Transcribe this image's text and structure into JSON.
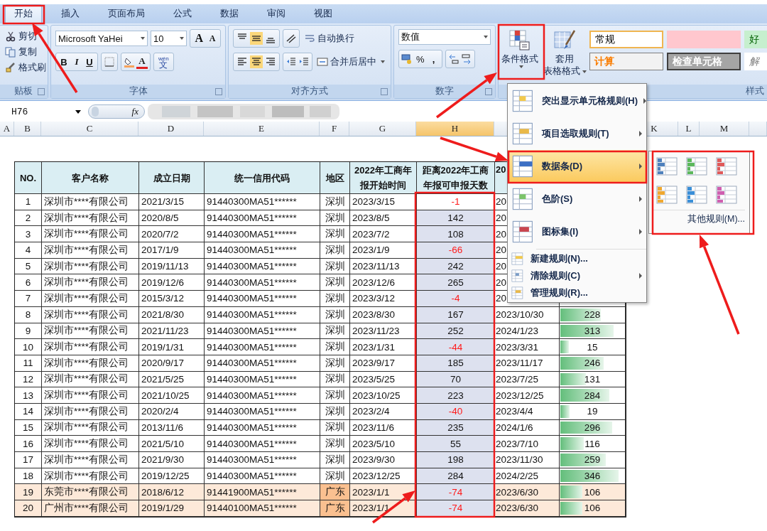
{
  "tabs": [
    {
      "label": "开始",
      "selected": true
    },
    {
      "label": "插入",
      "selected": false
    },
    {
      "label": "页面布局",
      "selected": false
    },
    {
      "label": "公式",
      "selected": false
    },
    {
      "label": "数据",
      "selected": false
    },
    {
      "label": "审阅",
      "selected": false
    },
    {
      "label": "视图",
      "selected": false
    }
  ],
  "ribbon": {
    "clipboard": {
      "label": "贴板",
      "items": [
        "剪切",
        "复制",
        "格式刷"
      ]
    },
    "font": {
      "label": "字体",
      "family": "Microsoft YaHei",
      "size": "10",
      "grow": "A",
      "shrink": "A",
      "bold": "B",
      "italic": "I",
      "underline": "U",
      "color_letter": "A",
      "phonetic_top": "wén",
      "phonetic": "文"
    },
    "alignment": {
      "label": "对齐方式",
      "vertical": [
        {
          "kind": "top",
          "selected": false
        },
        {
          "kind": "middle",
          "selected": true
        },
        {
          "kind": "bottom",
          "selected": false
        }
      ],
      "horizontal": [
        {
          "kind": "left",
          "selected": false
        },
        {
          "kind": "center",
          "selected": true
        },
        {
          "kind": "right",
          "selected": false
        }
      ],
      "wrap": "自动换行",
      "merge": "合并后居中"
    },
    "number": {
      "label": "数字",
      "format": "数值",
      "percent": "%",
      "comma": ","
    },
    "styles": {
      "label": "样式",
      "conditional": "条件格式",
      "table_format": [
        "套用",
        "表格格式"
      ],
      "cells": [
        {
          "kind": "normal",
          "text": "常规"
        },
        {
          "kind": "bad"
        },
        {
          "kind": "good",
          "text": "好"
        },
        {
          "kind": "calc",
          "text": "计算"
        },
        {
          "kind": "check",
          "text": "检查单元格"
        },
        {
          "kind": "explain",
          "text": "解"
        }
      ]
    }
  },
  "name_box": "H76",
  "fx": "fx",
  "columns": [
    {
      "label": "A",
      "selected": false
    },
    {
      "label": "B",
      "selected": false
    },
    {
      "label": "C",
      "selected": false
    },
    {
      "label": "D",
      "selected": false
    },
    {
      "label": "E",
      "selected": false
    },
    {
      "label": "F",
      "selected": false
    },
    {
      "label": "G",
      "selected": false
    },
    {
      "label": "H",
      "selected": true
    }
  ],
  "columns_right": [
    {
      "label": "K",
      "selected": false
    },
    {
      "label": "L",
      "selected": false
    },
    {
      "label": "M",
      "selected": false
    }
  ],
  "table": {
    "headers": [
      [
        "NO."
      ],
      [
        "客户名称"
      ],
      [
        "成立日期"
      ],
      [
        "统一信用代码"
      ],
      [
        "地区"
      ],
      [
        "2022年工商年",
        "报开始时间"
      ],
      [
        "距离2022年工商",
        "年报可申报天数"
      ],
      [
        "20"
      ]
    ],
    "rows": [
      {
        "no": "1",
        "name": "深圳市****有限公司",
        "founded": "2021/3/15",
        "code": "91440300MA51******",
        "region": "深圳",
        "start": "2023/3/15",
        "days": {
          "text": "-1",
          "negative": true,
          "active": true
        },
        "due": "20",
        "highlight": false
      },
      {
        "no": "2",
        "name": "深圳市****有限公司",
        "founded": "2020/8/5",
        "code": "91440300MA51******",
        "region": "深圳",
        "start": "2023/8/5",
        "days": {
          "text": "142",
          "negative": false,
          "active": false
        },
        "due": "20",
        "highlight": false
      },
      {
        "no": "3",
        "name": "深圳市****有限公司",
        "founded": "2020/7/2",
        "code": "91440300MA51******",
        "region": "深圳",
        "start": "2023/7/2",
        "days": {
          "text": "108",
          "negative": false,
          "active": false
        },
        "due": "20",
        "highlight": false
      },
      {
        "no": "4",
        "name": "深圳市****有限公司",
        "founded": "2017/1/9",
        "code": "91440300MA51******",
        "region": "深圳",
        "start": "2023/1/9",
        "days": {
          "text": "-66",
          "negative": true,
          "active": false
        },
        "due": "20",
        "highlight": false
      },
      {
        "no": "5",
        "name": "深圳市****有限公司",
        "founded": "2019/11/13",
        "code": "91440300MA51******",
        "region": "深圳",
        "start": "2023/11/13",
        "days": {
          "text": "242",
          "negative": false,
          "active": false
        },
        "due": "20",
        "highlight": false
      },
      {
        "no": "6",
        "name": "深圳市****有限公司",
        "founded": "2019/12/6",
        "code": "91440300MA51******",
        "region": "深圳",
        "start": "2023/12/6",
        "days": {
          "text": "265",
          "negative": false,
          "active": false
        },
        "due": "20",
        "highlight": false
      },
      {
        "no": "7",
        "name": "深圳市****有限公司",
        "founded": "2015/3/12",
        "code": "91440300MA51******",
        "region": "深圳",
        "start": "2023/3/12",
        "days": {
          "text": "-4",
          "negative": true,
          "active": false
        },
        "due": "20",
        "highlight": false
      },
      {
        "no": "8",
        "name": "深圳市****有限公司",
        "founded": "2021/8/30",
        "code": "91440300MA51******",
        "region": "深圳",
        "start": "2023/8/30",
        "days": {
          "text": "167",
          "negative": false,
          "active": false
        },
        "due": "2023/10/30",
        "overdue": {
          "text": "228",
          "level": 0.62
        },
        "highlight": false
      },
      {
        "no": "9",
        "name": "深圳市****有限公司",
        "founded": "2021/11/23",
        "code": "91440300MA51******",
        "region": "深圳",
        "start": "2023/11/23",
        "days": {
          "text": "252",
          "negative": false,
          "active": false
        },
        "due": "2024/1/23",
        "overdue": {
          "text": "313",
          "level": 0.82
        },
        "highlight": false
      },
      {
        "no": "10",
        "name": "深圳市****有限公司",
        "founded": "2019/1/31",
        "code": "91440300MA51******",
        "region": "深圳",
        "start": "2023/1/31",
        "days": {
          "text": "-44",
          "negative": true,
          "active": false
        },
        "due": "2023/3/31",
        "overdue": {
          "text": "15",
          "level": 0.13
        },
        "highlight": false
      },
      {
        "no": "11",
        "name": "深圳市****有限公司",
        "founded": "2020/9/17",
        "code": "91440300MA51******",
        "region": "深圳",
        "start": "2023/9/17",
        "days": {
          "text": "185",
          "negative": false,
          "active": false
        },
        "due": "2023/11/17",
        "overdue": {
          "text": "246",
          "level": 0.66
        },
        "highlight": false
      },
      {
        "no": "12",
        "name": "深圳市****有限公司",
        "founded": "2021/5/25",
        "code": "91440300MA51******",
        "region": "深圳",
        "start": "2023/5/25",
        "days": {
          "text": "70",
          "negative": false,
          "active": false
        },
        "due": "2023/7/25",
        "overdue": {
          "text": "131",
          "level": 0.39
        },
        "highlight": false
      },
      {
        "no": "13",
        "name": "深圳市****有限公司",
        "founded": "2021/10/25",
        "code": "91440300MA51******",
        "region": "深圳",
        "start": "2023/10/25",
        "days": {
          "text": "223",
          "negative": false,
          "active": false
        },
        "due": "2023/12/25",
        "overdue": {
          "text": "284",
          "level": 0.75
        },
        "highlight": false
      },
      {
        "no": "14",
        "name": "深圳市****有限公司",
        "founded": "2020/2/4",
        "code": "91440300MA51******",
        "region": "深圳",
        "start": "2023/2/4",
        "days": {
          "text": "-40",
          "negative": true,
          "active": false
        },
        "due": "2023/4/4",
        "overdue": {
          "text": "19",
          "level": 0.14
        },
        "highlight": false
      },
      {
        "no": "15",
        "name": "深圳市****有限公司",
        "founded": "2013/11/6",
        "code": "91440300MA51******",
        "region": "深圳",
        "start": "2023/11/6",
        "days": {
          "text": "235",
          "negative": false,
          "active": false
        },
        "due": "2024/1/6",
        "overdue": {
          "text": "296",
          "level": 0.79
        },
        "highlight": false
      },
      {
        "no": "16",
        "name": "深圳市****有限公司",
        "founded": "2021/5/10",
        "code": "91440300MA51******",
        "region": "深圳",
        "start": "2023/5/10",
        "days": {
          "text": "55",
          "negative": false,
          "active": false
        },
        "due": "2023/7/10",
        "overdue": {
          "text": "116",
          "level": 0.36
        },
        "highlight": false
      },
      {
        "no": "17",
        "name": "深圳市****有限公司",
        "founded": "2021/9/30",
        "code": "91440300MA51******",
        "region": "深圳",
        "start": "2023/9/30",
        "days": {
          "text": "198",
          "negative": false,
          "active": false
        },
        "due": "2023/11/30",
        "overdue": {
          "text": "259",
          "level": 0.7
        },
        "highlight": false
      },
      {
        "no": "18",
        "name": "深圳市****有限公司",
        "founded": "2019/12/25",
        "code": "91440300MA51******",
        "region": "深圳",
        "start": "2023/12/25",
        "days": {
          "text": "284",
          "negative": false,
          "active": false
        },
        "due": "2024/2/25",
        "overdue": {
          "text": "346",
          "level": 0.89
        },
        "highlight": false
      },
      {
        "no": "19",
        "name": "东莞市****有限公司",
        "founded": "2018/6/12",
        "code": "91441900MA51******",
        "region": "广东",
        "start": "2023/1/1",
        "days": {
          "text": "-74",
          "negative": true,
          "active": false
        },
        "due": "2023/6/30",
        "overdue": {
          "text": "106",
          "level": 0.34
        },
        "highlight": true
      },
      {
        "no": "20",
        "name": "广州市****有限公司",
        "founded": "2019/1/29",
        "code": "91440100MA51******",
        "region": "广东",
        "start": "2023/1/1",
        "days": {
          "text": "-74",
          "negative": true,
          "active": false
        },
        "due": "2023/6/30",
        "overdue": {
          "text": "106",
          "level": 0.34
        },
        "highlight": true
      }
    ]
  },
  "menu": {
    "items": [
      {
        "kind": "large",
        "label": "突出显示单元格规则(H)",
        "submenu": true,
        "selected": false
      },
      {
        "kind": "large",
        "label": "项目选取规则(T)",
        "submenu": true,
        "selected": false
      },
      {
        "kind": "large",
        "label": "数据条(D)",
        "submenu": true,
        "selected": true
      },
      {
        "kind": "large",
        "label": "色阶(S)",
        "submenu": true,
        "selected": false
      },
      {
        "kind": "large",
        "label": "图标集(I)",
        "submenu": true,
        "selected": false
      },
      {
        "kind": "small",
        "label": "新建规则(N)...",
        "submenu": false,
        "selected": false
      },
      {
        "kind": "small",
        "label": "清除规则(C)",
        "submenu": true,
        "selected": false
      },
      {
        "kind": "small",
        "label": "管理规则(R)...",
        "submenu": false,
        "selected": false
      }
    ]
  },
  "submenu": {
    "bars": [
      {
        "color": "#4f81bd"
      },
      {
        "color": "#5cb85c"
      },
      {
        "color": "#e05a5a"
      },
      {
        "color": "#f0a830"
      },
      {
        "color": "#3a8fd8"
      },
      {
        "color": "#d05fb0"
      }
    ],
    "more": "其他规则(M)..."
  }
}
